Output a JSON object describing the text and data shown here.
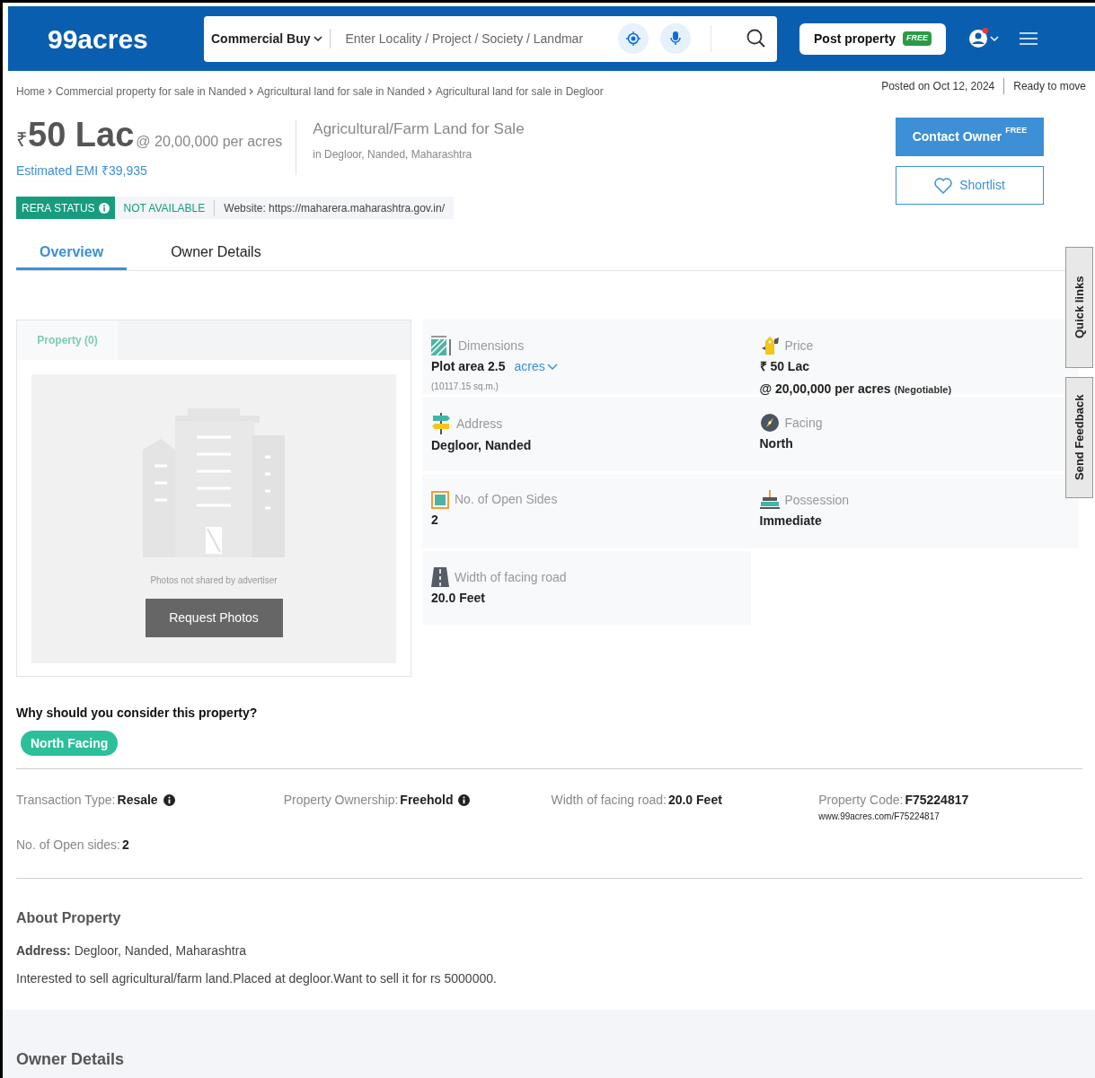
{
  "header": {
    "logo": "99acres",
    "category": "Commercial Buy",
    "placeholder": "Enter Locality / Project / Society / Landmar",
    "post": {
      "label": "Post property",
      "badge": "FREE"
    },
    "notification": true
  },
  "breadcrumbs": [
    "Home",
    "Commercial property for sale in Nanded",
    "Agricultural land for sale in Nanded",
    "Agricultural land for sale in Degloor"
  ],
  "meta": [
    "Posted on Oct 12, 2024",
    "Ready to move"
  ],
  "price": {
    "currency": "₹",
    "amount": "50 Lac",
    "rate": "@ 20,00,000 per acres",
    "emi": "Estimated EMI ₹39,935"
  },
  "title": "Agricultural/Farm Land for Sale",
  "location": "in Degloor, Nanded, Maharashtra",
  "rera": {
    "label": "RERA STATUS",
    "status": "NOT AVAILABLE",
    "website": "Website: https://maharera.maharashtra.gov.in/"
  },
  "actions": {
    "contact": {
      "label": "Contact Owner",
      "badge": "FREE"
    },
    "shortlist": "Shortlist"
  },
  "tabs": [
    {
      "label": "Overview",
      "selected": true
    },
    {
      "label": "Owner Details",
      "selected": false
    }
  ],
  "gallery": {
    "tab": "Property (0)",
    "note": "Photos not shared by advertiser",
    "button": "Request Photos"
  },
  "details": [
    {
      "kind": "dimensions",
      "label": "Dimensions",
      "value": "Plot area 2.5",
      "unit": "acres",
      "sub": "(10117.15 sq.m.)"
    },
    {
      "kind": "price",
      "label": "Price",
      "value": "₹ 50 Lac",
      "sub": "@ 20,00,000 per acres",
      "note": "(Negotiable)"
    },
    {
      "kind": "address",
      "label": "Address",
      "value": "Degloor, Nanded"
    },
    {
      "kind": "facing",
      "label": "Facing",
      "value": "North"
    },
    {
      "kind": "sides",
      "label": "No. of Open Sides",
      "value": "2"
    },
    {
      "kind": "possession",
      "label": "Possession",
      "value": "Immediate"
    },
    {
      "kind": "road",
      "label": "Width of facing road",
      "value": "20.0 Feet"
    }
  ],
  "side_tabs": [
    "Quick links",
    "Send Feedback"
  ],
  "highlights": {
    "title": "Why should you consider this property?",
    "tags": [
      "North Facing"
    ]
  },
  "facts": [
    {
      "label": "Transaction Type:",
      "value": "Resale",
      "info": true
    },
    {
      "label": "Property Ownership:",
      "value": "Freehold",
      "info": true
    },
    {
      "label": "Width of facing road:",
      "value": "20.0 Feet",
      "info": false
    },
    {
      "label": "Property Code:",
      "value": "F75224817",
      "info": false,
      "sub": "www.99acres.com/F75224817"
    },
    {
      "label": "No. of Open sides:",
      "value": "2",
      "info": false
    }
  ],
  "about": {
    "title": "About Property",
    "address_label": "Address:",
    "address": "Degloor, Nanded, Maharashtra",
    "description": "Interested to sell agricultural/farm land.Placed at degloor.Want to sell it for rs 5000000."
  },
  "owner_title": "Owner Details"
}
